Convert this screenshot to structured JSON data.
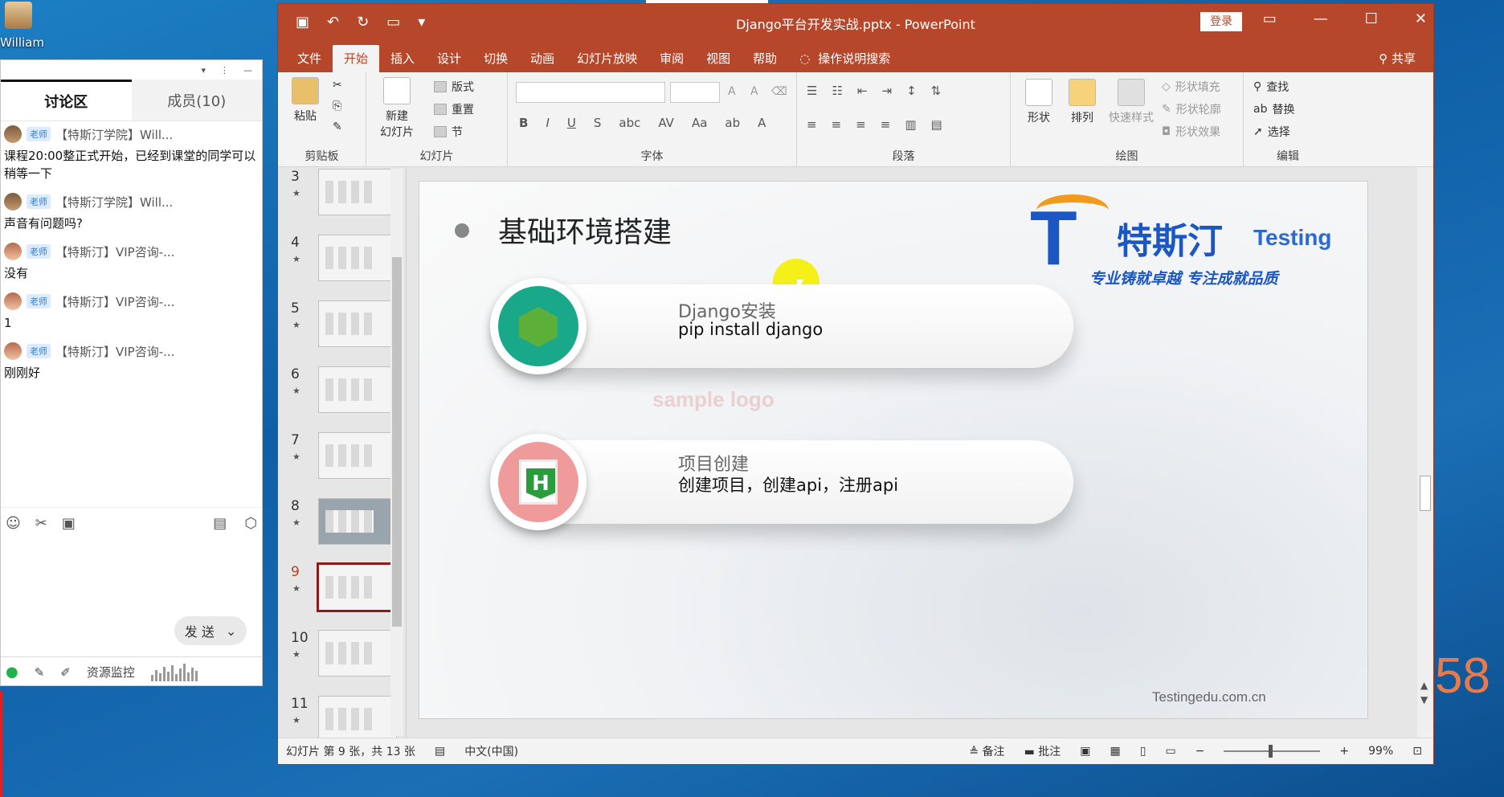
{
  "desktop": {
    "user_name": "William"
  },
  "chat": {
    "tabs": [
      "讨论区",
      "成员(10)"
    ],
    "messages": [
      {
        "sender": "【特斯汀学院】Will...",
        "role": "老师",
        "text": "课程20:00整正式开始，已经到课堂的同学可以稍等一下"
      },
      {
        "sender": "【特斯汀学院】Will...",
        "role": "老师",
        "text": "声音有问题吗?"
      },
      {
        "sender": "【特斯汀】VIP咨询-...",
        "role": "老师",
        "text": "没有"
      },
      {
        "sender": "【特斯汀】VIP咨询-...",
        "role": "老师",
        "text": "1"
      },
      {
        "sender": "【特斯汀】VIP咨询-...",
        "role": "老师",
        "text": "刚刚好"
      }
    ],
    "send_label": "发 送",
    "resource_monitor": "资源监控"
  },
  "ppt": {
    "title": "Django平台开发实战.pptx  -  PowerPoint",
    "login": "登录",
    "tabs": [
      "文件",
      "开始",
      "插入",
      "设计",
      "切换",
      "动画",
      "幻灯片放映",
      "审阅",
      "视图",
      "帮助"
    ],
    "search_hint": "操作说明搜索",
    "share": "共享",
    "ribbon": {
      "clipboard": {
        "label": "剪贴板",
        "paste": "粘贴"
      },
      "slides": {
        "label": "幻灯片",
        "new_slide": "新建\n幻灯片",
        "layout": "版式",
        "reset": "重置",
        "section": "节"
      },
      "font": {
        "label": "字体"
      },
      "paragraph": {
        "label": "段落"
      },
      "drawing": {
        "label": "绘图",
        "shapes": "形状",
        "arrange": "排列",
        "quick_styles": "快速样式",
        "fill": "形状填充",
        "outline": "形状轮廓",
        "effects": "形状效果"
      },
      "editing": {
        "label": "编辑",
        "find": "查找",
        "replace": "替换",
        "select": "选择"
      }
    },
    "thumbnails": [
      "3",
      "4",
      "5",
      "6",
      "7",
      "8",
      "9",
      "10",
      "11"
    ],
    "selected_slide": "9",
    "slide": {
      "title": "基础环境搭建",
      "logo_cn": "特斯汀",
      "logo_en": "Testing",
      "slogan": "专业铸就卓越  专注成就品质",
      "items": [
        {
          "title": "Django安装",
          "text": "pip install django",
          "color": "#1aa88b"
        },
        {
          "title": "项目创建",
          "text": "创建项目，创建api，注册api",
          "color": "#ef9b9b"
        }
      ],
      "watermark": "sample logo",
      "footer": "Testingedu.com.cn"
    },
    "status": {
      "slide_info": "幻灯片 第 9 张，共 13 张",
      "language": "中文(中国)",
      "notes": "备注",
      "comments": "批注",
      "zoom": "99%"
    }
  },
  "overlay_number": "58"
}
